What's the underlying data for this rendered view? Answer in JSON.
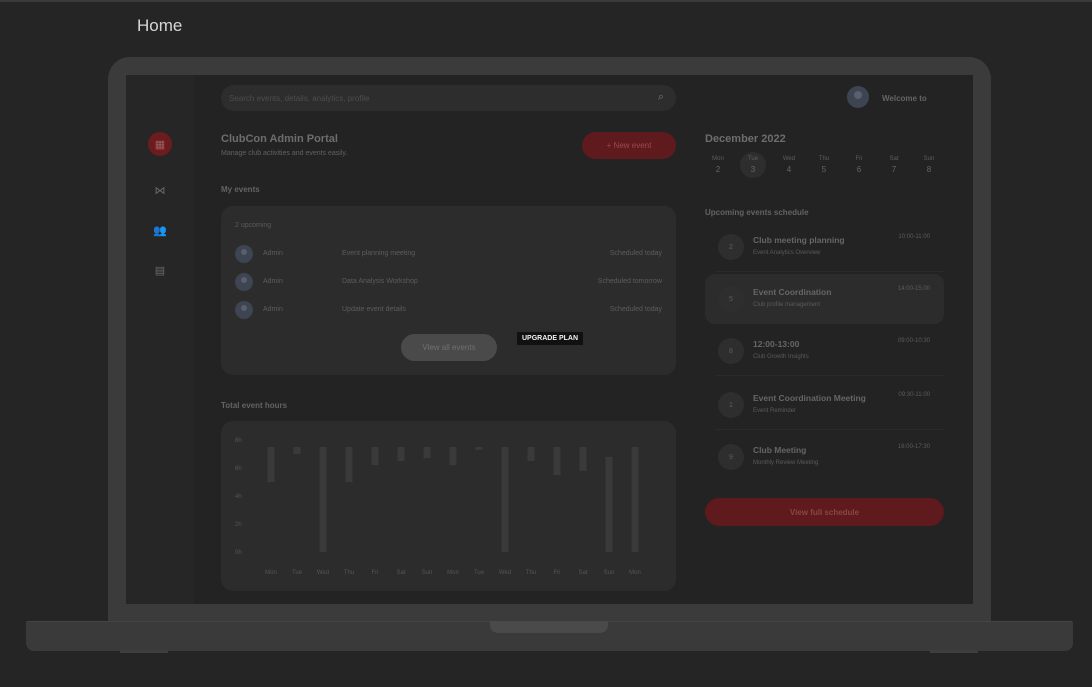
{
  "page": {
    "title": "Home"
  },
  "search": {
    "placeholder": "Search events, details, analytics, profile",
    "icon": "search-icon"
  },
  "sidebar": {
    "items": [
      {
        "icon": "dashboard-icon",
        "active": true
      },
      {
        "icon": "share-nodes-icon",
        "active": false
      },
      {
        "icon": "users-icon",
        "active": false
      },
      {
        "icon": "calendar-icon",
        "active": false
      }
    ]
  },
  "header": {
    "title": "ClubCon Admin Portal",
    "subtitle": "Manage club activities and events easily.",
    "new_event_label": "+ New event"
  },
  "user": {
    "welcome": "Welcome to"
  },
  "my_events": {
    "label": "My events",
    "upcoming_count": "2 upcoming",
    "rows": [
      {
        "author": "Admin",
        "name": "Event planning meeting",
        "status": "Scheduled today"
      },
      {
        "author": "Admin",
        "name": "Data Analysis Workshop",
        "status": "Scheduled tomorrow"
      },
      {
        "author": "Admin",
        "name": "Update event details",
        "status": "Scheduled today"
      }
    ],
    "view_all_label": "View all events"
  },
  "upgrade_label": "UPGRADE PLAN",
  "chart_data": {
    "type": "bar",
    "title": "Total event hours",
    "categories": [
      "Mon",
      "Tue",
      "Wed",
      "Thu",
      "Fri",
      "Sat",
      "Sun",
      "Mon",
      "Tue",
      "Wed",
      "Thu",
      "Fri",
      "Sat",
      "Sun",
      "Mon"
    ],
    "series": [
      {
        "values": [
          [
            5,
            7.5
          ],
          [
            7,
            7.5
          ],
          [
            0,
            7.5
          ],
          [
            5,
            7.5
          ],
          [
            6.2,
            7.5
          ],
          [
            6.5,
            7.5
          ],
          [
            6.7,
            7.5
          ],
          [
            6.2,
            7.5
          ],
          [
            7.3,
            7.5
          ],
          [
            0,
            7.5
          ],
          [
            6.5,
            7.5
          ],
          [
            5.5,
            7.5
          ],
          [
            5.8,
            7.5
          ],
          [
            0,
            6.8
          ],
          [
            0,
            7.5
          ]
        ]
      }
    ],
    "value_format": "[start_hour, end_hour]",
    "ytick_labels": [
      "8h",
      "6h",
      "4h",
      "2h",
      "0h"
    ],
    "ylim": [
      0,
      8
    ],
    "grid": false
  },
  "calendar": {
    "title": "December 2022",
    "days": [
      {
        "name": "Mon",
        "date": "2",
        "selected": false
      },
      {
        "name": "Tue",
        "date": "3",
        "selected": true
      },
      {
        "name": "Wed",
        "date": "4",
        "selected": false
      },
      {
        "name": "Thu",
        "date": "5",
        "selected": false
      },
      {
        "name": "Fri",
        "date": "6",
        "selected": false
      },
      {
        "name": "Sat",
        "date": "7",
        "selected": false
      },
      {
        "name": "Sun",
        "date": "8",
        "selected": false
      }
    ]
  },
  "schedule": {
    "label": "Upcoming events schedule",
    "items": [
      {
        "num": "2",
        "title": "Club meeting planning",
        "subtitle": "Event Analytics Overview",
        "time": "10:00-11:00",
        "highlight": false
      },
      {
        "num": "5",
        "title": "Event Coordination",
        "subtitle": "Club profile management",
        "time": "14:00-15:00",
        "highlight": true
      },
      {
        "num": "8",
        "title": "12:00-13:00",
        "subtitle": "Club Growth Insights",
        "time": "09:00-10:30",
        "highlight": false
      },
      {
        "num": "1",
        "title": "Event Coordination Meeting",
        "subtitle": "Event Reminder",
        "time": "09:30-11:00",
        "highlight": false
      },
      {
        "num": "9",
        "title": "Club Meeting",
        "subtitle": "Monthly Review Meeting",
        "time": "16:00-17:30",
        "highlight": false
      }
    ],
    "full_label": "View full schedule"
  },
  "colors": {
    "accent": "#5f1a1d",
    "background": "#252525",
    "card": "#2c2c2c"
  }
}
